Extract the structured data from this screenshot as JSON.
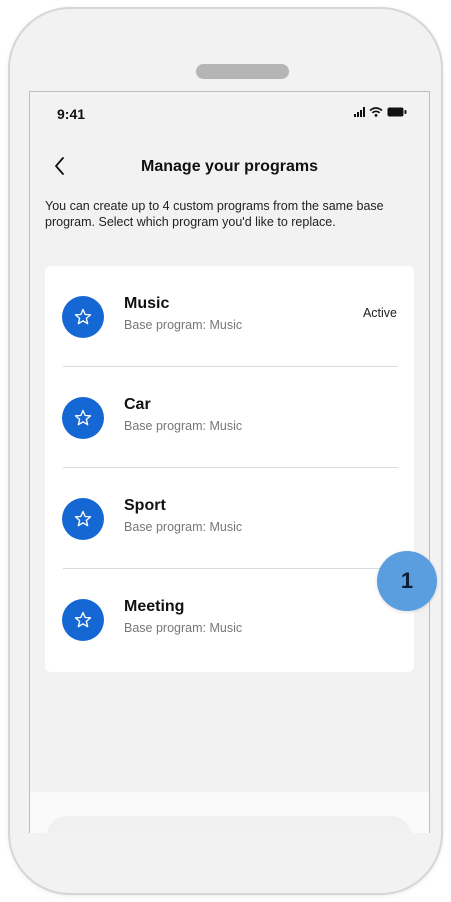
{
  "status_bar": {
    "time": "9:41"
  },
  "header": {
    "title": "Manage your programs",
    "back_icon": "chevron-left-icon"
  },
  "description": "You can create up to 4 custom programs from the same base program. Select which program you'd like to replace.",
  "programs": [
    {
      "name": "Music",
      "base": "Base program: Music",
      "status": "Active",
      "icon": "star-icon"
    },
    {
      "name": "Car",
      "base": "Base program: Music",
      "status": "",
      "icon": "star-icon"
    },
    {
      "name": "Sport",
      "base": "Base program: Music",
      "status": "",
      "icon": "star-icon"
    },
    {
      "name": "Meeting",
      "base": "Base program: Music",
      "status": "",
      "icon": "star-icon"
    }
  ],
  "annotation": {
    "step_number": "1"
  },
  "colors": {
    "accent": "#1567d3",
    "badge": "#5b9ee0",
    "background": "#f2f2f2"
  }
}
